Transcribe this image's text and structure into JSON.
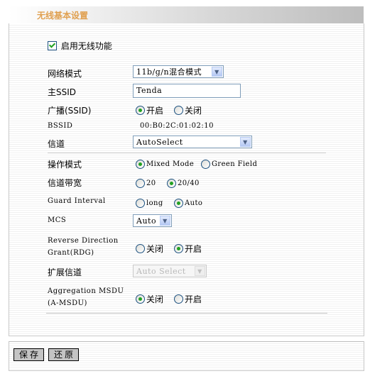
{
  "header": {
    "title": "无线基本设置"
  },
  "enable_wireless": {
    "label": "启用无线功能",
    "checked": true
  },
  "fields": {
    "network_mode": {
      "label": "网络模式",
      "value": "11b/g/n混合模式"
    },
    "main_ssid": {
      "label": "主SSID",
      "value": "Tenda"
    },
    "broadcast": {
      "label": "广播(SSID)",
      "options": [
        "开启",
        "关闭"
      ],
      "selected": "开启"
    },
    "bssid": {
      "label": "BSSID",
      "value": "00:B0:2C:01:02:10"
    },
    "channel": {
      "label": "信道",
      "value": "AutoSelect"
    },
    "op_mode": {
      "label": "操作模式",
      "options": [
        "Mixed Mode",
        "Green Field"
      ],
      "selected": "Mixed Mode"
    },
    "channel_bw": {
      "label": "信道带宽",
      "options": [
        "20",
        "20/40"
      ],
      "selected": "20/40"
    },
    "guard_interval": {
      "label": "Guard Interval",
      "options": [
        "long",
        "Auto"
      ],
      "selected": "Auto"
    },
    "mcs": {
      "label": "MCS",
      "value": "Auto"
    },
    "rdg": {
      "label_line1": "Reverse Direction",
      "label_line2": "Grant(RDG)",
      "options": [
        "关闭",
        "开启"
      ],
      "selected": "开启"
    },
    "ext_channel": {
      "label": "扩展信道",
      "value": "Auto Select",
      "disabled": true
    },
    "amsdu": {
      "label_line1": "Aggregation MSDU",
      "label_line2": "(A-MSDU)",
      "options": [
        "关闭",
        "开启"
      ],
      "selected": "关闭"
    }
  },
  "buttons": {
    "save": "保存",
    "restore": "还原"
  },
  "icons": {
    "dropdown": "▼"
  },
  "colors": {
    "header_title": "#e0a050",
    "radio_dot": "#21a121",
    "control_border": "#7f9db9"
  }
}
